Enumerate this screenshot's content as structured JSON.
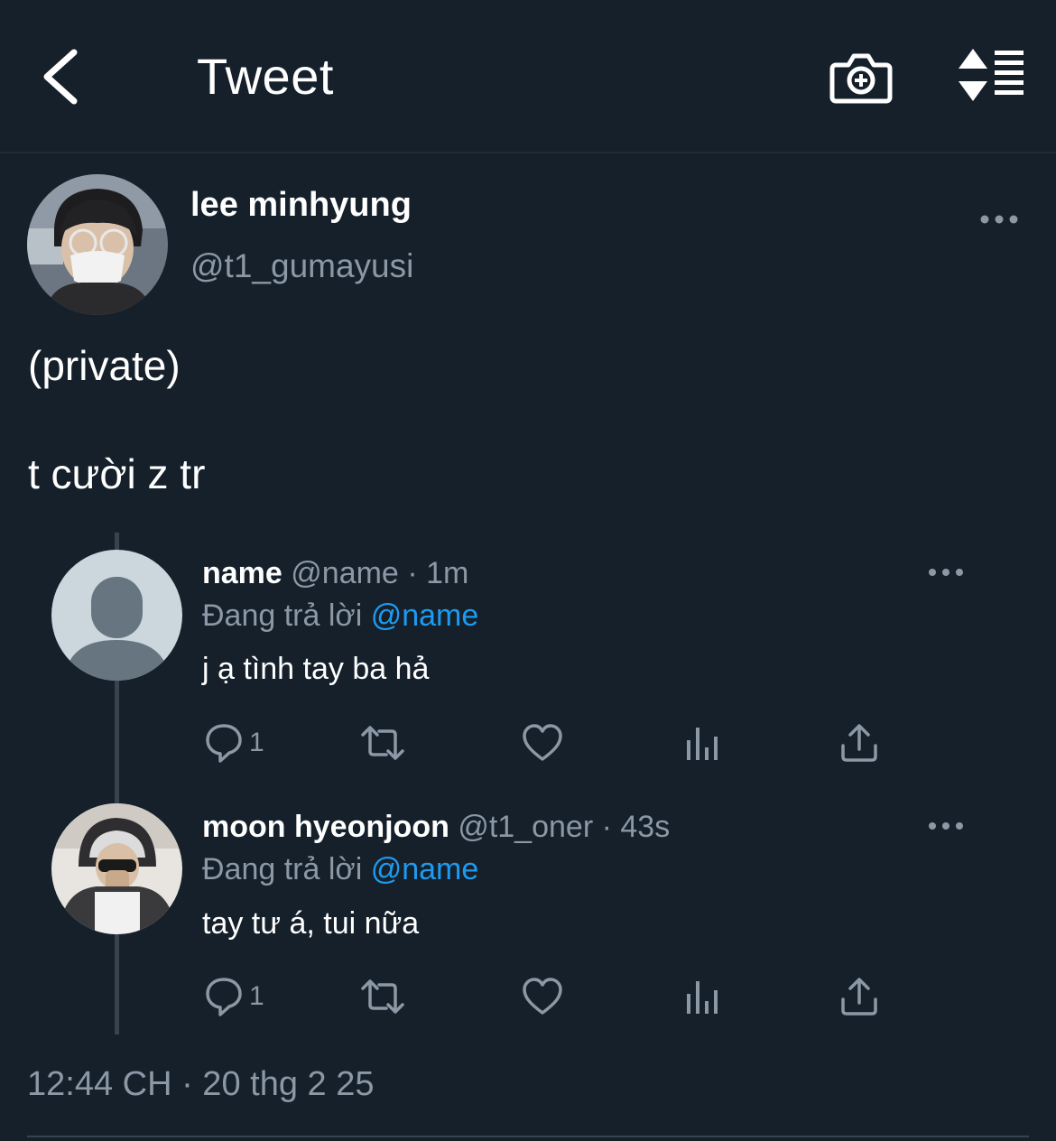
{
  "header": {
    "title": "Tweet",
    "icons": [
      "back-icon",
      "camera-plus-icon",
      "sort-icon"
    ]
  },
  "tweet": {
    "author_name": "lee minhyung",
    "author_handle": "@t1_gumayusi",
    "lines": [
      "(private)",
      "t cười z tr"
    ],
    "timestamp": "12:44 CH · 20 thg 2 25"
  },
  "replies": [
    {
      "name": "name",
      "handle": "@name",
      "time": "1m",
      "replying_label": "Đang trả lời",
      "replying_to": "@name",
      "text": "j ạ tình tay ba hả",
      "reply_count": "1"
    },
    {
      "name": "moon hyeonjoon",
      "handle": "@t1_oner",
      "time": "43s",
      "replying_label": "Đang trả lời",
      "replying_to": "@name",
      "text": "tay tư á, tui nữa",
      "reply_count": "1"
    }
  ],
  "colors": {
    "background": "#15202b",
    "muted": "#8b98a5",
    "link": "#1d9bf0",
    "divider": "#38444d"
  }
}
